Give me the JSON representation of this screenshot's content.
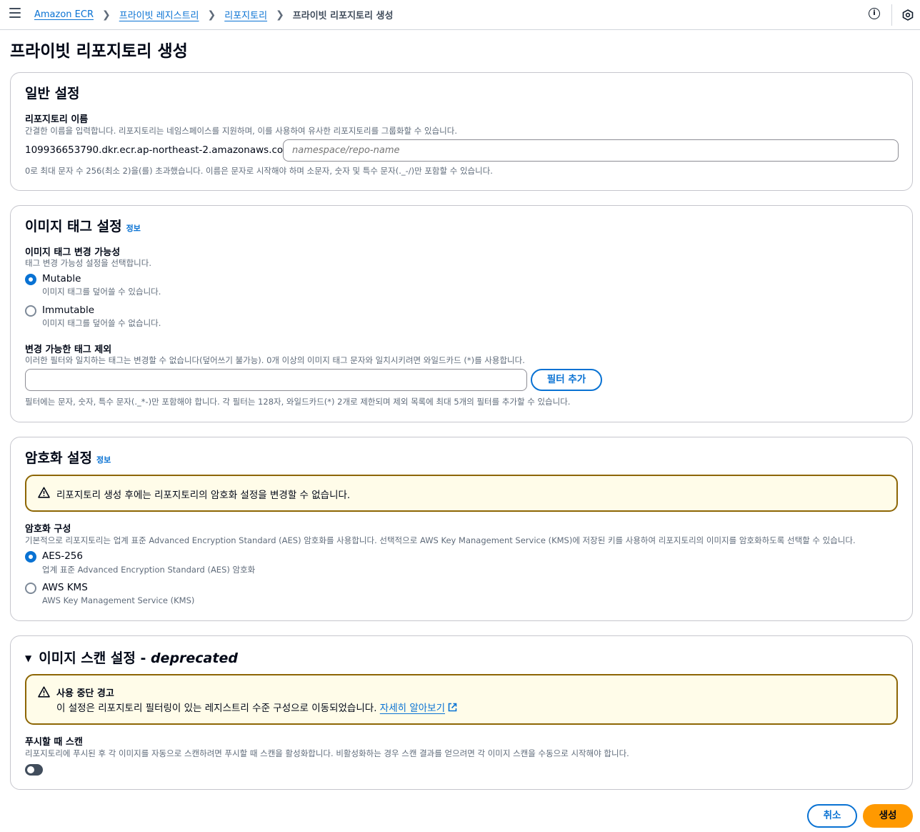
{
  "topnav": {
    "breadcrumbs": [
      "Amazon ECR",
      "프라이빗 레지스트리",
      "리포지토리"
    ],
    "current": "프라이빗 리포지토리 생성",
    "info_icon": "info-circle-icon",
    "settings_icon": "cube-settings-icon"
  },
  "page": {
    "title": "프라이빗 리포지토리 생성"
  },
  "general": {
    "title": "일반 설정",
    "repo_name_label": "리포지토리 이름",
    "repo_name_desc": "간결한 이름을 입력합니다. 리포지토리는 네임스페이스를 지원하며, 이를 사용하여 유사한 리포지토리를 그룹화할 수 있습니다.",
    "registry_prefix": "109936653790.dkr.ecr.ap-northeast-2.amazonaws.com/",
    "repo_name_placeholder": "namespace/repo-name",
    "repo_name_value": "",
    "constraint": "0로 최대 문자 수 256(최소 2)을(를) 초과했습니다. 이름은 문자로 시작해야 하며 소문자, 숫자 및 특수 문자(._-/)만 포함할 수 있습니다."
  },
  "tag": {
    "title": "이미지 태그 설정",
    "info": "정보",
    "mutability_label": "이미지 태그 변경 가능성",
    "mutability_desc": "태그 변경 가능성 설정을 선택합니다.",
    "options": [
      {
        "label": "Mutable",
        "desc": "이미지 태그를 덮어쓸 수 있습니다.",
        "selected": true
      },
      {
        "label": "Immutable",
        "desc": "이미지 태그를 덮어쓸 수 없습니다.",
        "selected": false
      }
    ],
    "exclusion_label": "변경 가능한 태그 제외",
    "exclusion_desc": "이러한 필터와 일치하는 태그는 변경할 수 없습니다(덮어쓰기 불가능). 0개 이상의 이미지 태그 문자와 일치시키려면 와일드카드 (*)를 사용합니다.",
    "filter_value": "",
    "add_filter_button": "필터 추가",
    "filter_constraint": "필터에는 문자, 숫자, 특수 문자(._*-)만 포함해야 합니다. 각 필터는 128자, 와일드카드(*) 2개로 제한되며 제외 목록에 최대 5개의 필터를 추가할 수 있습니다."
  },
  "encryption": {
    "title": "암호화 설정",
    "info": "정보",
    "warning": "리포지토리 생성 후에는 리포지토리의 암호화 설정을 변경할 수 없습니다.",
    "config_label": "암호화 구성",
    "config_desc": "기본적으로 리포지토리는 업계 표준 Advanced Encryption Standard (AES) 암호화를 사용합니다. 선택적으로 AWS Key Management Service (KMS)에 저장된 키를 사용하여 리포지토리의 이미지를 암호화하도록 선택할 수 있습니다.",
    "options": [
      {
        "label": "AES-256",
        "desc": "업계 표준 Advanced Encryption Standard (AES) 암호화",
        "selected": true
      },
      {
        "label": "AWS KMS",
        "desc": "AWS Key Management Service (KMS)",
        "selected": false
      }
    ]
  },
  "scan": {
    "title": "이미지 스캔 설정 - ",
    "title_suffix": "deprecated",
    "alert_title": "사용 중단 경고",
    "alert_text": "이 설정은 리포지토리 필터링이 있는 레지스트리 수준 구성으로 이동되었습니다. ",
    "alert_link": "자세히 알아보기",
    "scan_on_push_label": "푸시할 때 스캔",
    "scan_on_push_desc": "리포지토리에 푸시된 후 각 이미지를 자동으로 스캔하려면 푸시할 때 스캔을 활성화합니다. 비활성화하는 경우 스캔 결과를 얻으려면 각 이미지 스캔을 수동으로 시작해야 합니다.",
    "scan_on_push_enabled": false
  },
  "footer": {
    "cancel": "취소",
    "create": "생성"
  },
  "colors": {
    "primary": "#ff9900",
    "link": "#0972d3",
    "warning_border": "#8d6605",
    "warning_bg": "#fffce9"
  }
}
